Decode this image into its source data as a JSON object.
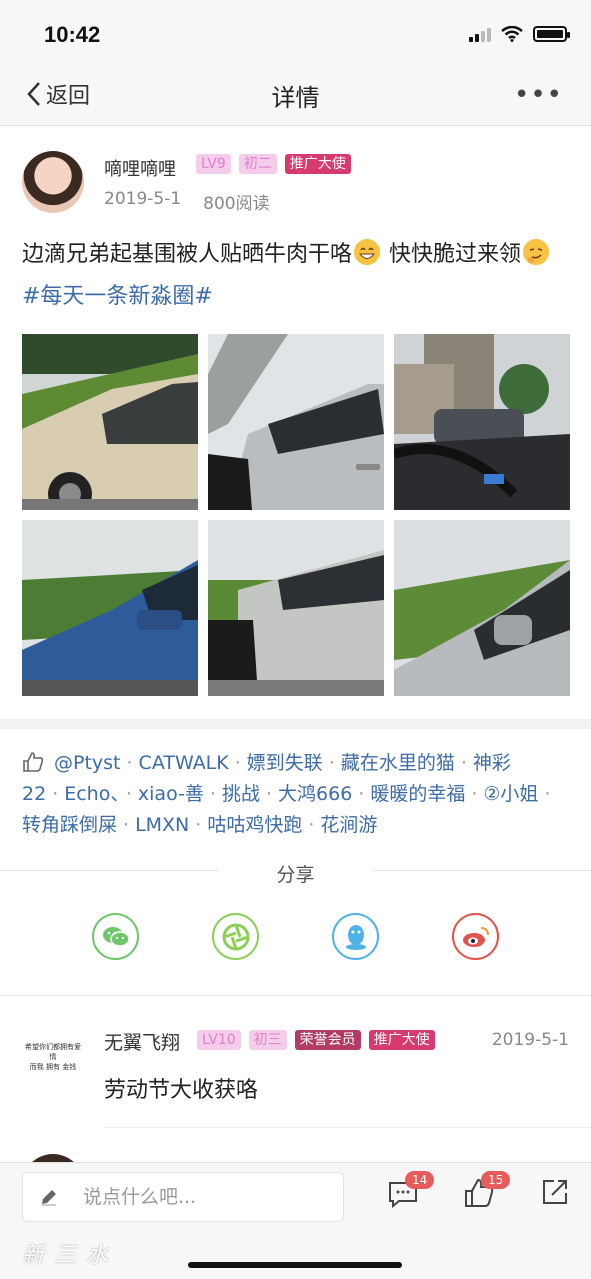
{
  "status": {
    "time": "10:42"
  },
  "nav": {
    "back_label": "返回",
    "title": "详情",
    "more": "•••"
  },
  "post": {
    "author": "嘀哩嘀哩",
    "badges": [
      "LV9",
      "初二",
      "推广大使"
    ],
    "date": "2019-5-1",
    "views": "800阅读",
    "text_part1": "边滴兄弟起基围被人贴晒牛肉干咯",
    "text_part2": " 快快脆过来领",
    "hashtag": "#每天一条新淼圈#"
  },
  "photos": [
    {
      "alt": "beige-van-photo"
    },
    {
      "alt": "silver-car-door-photo"
    },
    {
      "alt": "car-interior-photo"
    },
    {
      "alt": "blue-car-photo"
    },
    {
      "alt": "silver-van-photo"
    },
    {
      "alt": "grey-car-mirror-photo"
    }
  ],
  "likes": [
    "@Ptyst",
    "CATWALK",
    "嫖到失联",
    "藏在水里的猫",
    "神彩22",
    "Echo、",
    "xiao-善",
    "挑战",
    "大鸿666",
    "暖暖的幸福",
    "②小姐",
    "转角踩倒屎",
    "LMXN",
    "咕咕鸡快跑",
    "花涧游"
  ],
  "share": {
    "label": "分享",
    "targets": [
      "wechat",
      "moments",
      "qq",
      "weibo"
    ]
  },
  "comment": {
    "author": "无翼飞翔",
    "badges": [
      "LV10",
      "初三",
      "荣誉会员",
      "推广大使"
    ],
    "date": "2019-5-1",
    "text": "劳动节大收获咯",
    "avatar_text": "希望你们都拥有爱情",
    "avatar_subtext": "而我 拥有 金钱"
  },
  "bottom": {
    "input_placeholder": "说点什么吧...",
    "comment_count": "14",
    "like_count": "15",
    "watermark": "新三水"
  },
  "colors": {
    "link": "#3d6ca8",
    "badge_pink_bg": "#f3cdea",
    "badge_promo": "#d73a6e",
    "count_badge": "#e85b5b"
  }
}
